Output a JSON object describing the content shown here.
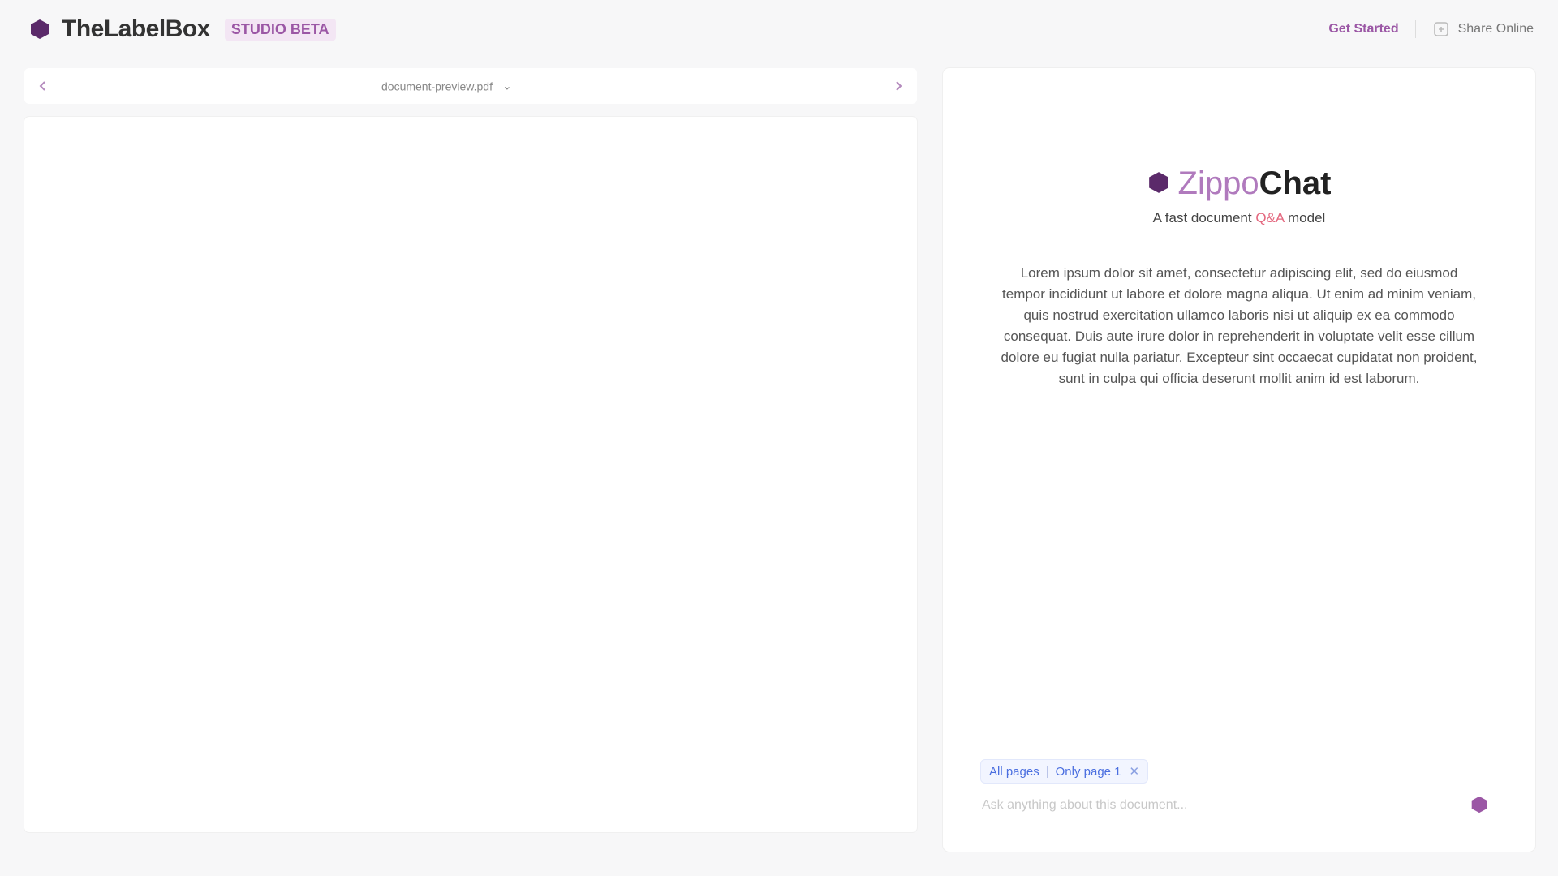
{
  "header": {
    "brand_name": "TheLabelBox",
    "brand_tag": "STUDIO BETA",
    "link_label": "Get Started",
    "share_label": "Share Online"
  },
  "viewer": {
    "doc_title": "document-preview.pdf",
    "title_chevron": "⌄"
  },
  "chat": {
    "title_part1": "Zippo",
    "title_part2": "Chat",
    "subtitle_prefix": "A fast document",
    "subtitle_highlight": "Q&A",
    "subtitle_suffix": "model",
    "description": "Lorem ipsum dolor sit amet, consectetur adipiscing elit, sed do eiusmod tempor incididunt ut labore et dolore magna aliqua. Ut enim ad minim veniam, quis nostrud exercitation ullamco laboris nisi ut aliquip ex ea commodo consequat. Duis aute irure dolor in reprehenderit in voluptate velit esse cillum dolore eu fugiat nulla pariatur. Excepteur sint occaecat cupidatat non proident, sunt in culpa qui officia deserunt mollit anim id est laborum.",
    "chips": [
      "All pages",
      "Only page 1"
    ],
    "chip_close": "✕",
    "input_placeholder": "Ask anything about this document..."
  },
  "colors": {
    "accent": "#9b57a5",
    "accent_dark": "#5b2a6a",
    "highlight": "#e4687f",
    "chip_blue": "#4b6fe0"
  }
}
